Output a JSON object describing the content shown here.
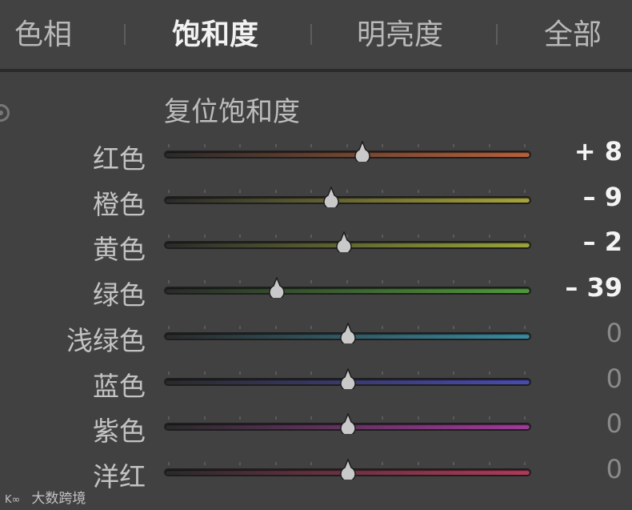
{
  "tabs": [
    {
      "label": "色相",
      "active": false
    },
    {
      "label": "饱和度",
      "active": true
    },
    {
      "label": "明亮度",
      "active": false
    },
    {
      "label": "全部",
      "active": false
    }
  ],
  "panel": {
    "reset_label": "复位饱和度",
    "sliders": [
      {
        "label": "红色",
        "value": 8,
        "display": "+ 8",
        "from": "#2a2a2a",
        "to": "#b8603a"
      },
      {
        "label": "橙色",
        "value": -9,
        "display": "– 9",
        "from": "#2a2a2a",
        "to": "#a9a53a"
      },
      {
        "label": "黄色",
        "value": -2,
        "display": "– 2",
        "from": "#2a2a2a",
        "to": "#9aa63a"
      },
      {
        "label": "绿色",
        "value": -39,
        "display": "– 39",
        "from": "#2a2a2a",
        "to": "#4f9a3a"
      },
      {
        "label": "浅绿色",
        "value": 0,
        "display": "0",
        "from": "#2a2a2a",
        "to": "#3a8aa0"
      },
      {
        "label": "蓝色",
        "value": 0,
        "display": "0",
        "from": "#2a2a2a",
        "to": "#4a4bb0"
      },
      {
        "label": "紫色",
        "value": 0,
        "display": "0",
        "from": "#2a2a2a",
        "to": "#a03a9a"
      },
      {
        "label": "洋红",
        "value": 0,
        "display": "0",
        "from": "#2a2a2a",
        "to": "#b03a5a"
      }
    ],
    "range": [
      -100,
      100
    ]
  },
  "watermark": {
    "text": "大数跨境"
  }
}
